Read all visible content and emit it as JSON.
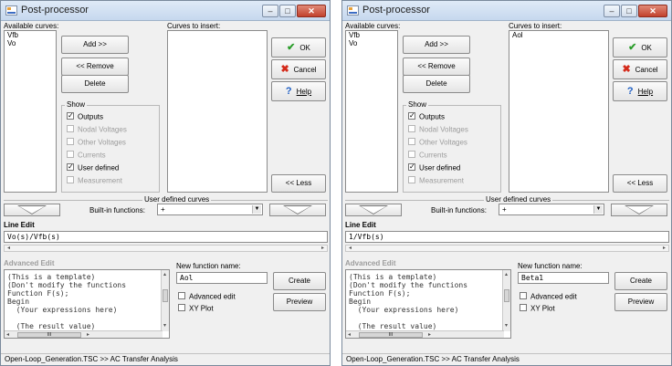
{
  "windows": [
    {
      "title": "Post-processor",
      "controls": {
        "minimize": "–",
        "maximize": "□",
        "close": "✕"
      },
      "available_curves_label": "Available curves:",
      "available_curves": [
        "Vfb",
        "Vo"
      ],
      "curves_to_insert_label": "Curves to insert:",
      "curves_to_insert": [],
      "buttons": {
        "add": "Add >>",
        "remove": "<< Remove",
        "delete": "Delete",
        "ok": "OK",
        "cancel": "Cancel",
        "help": "Help",
        "less": "<< Less",
        "create": "Create",
        "preview": "Preview"
      },
      "icons": {
        "ok": "✔",
        "cancel": "✖",
        "help": "?"
      },
      "show_label": "Show",
      "show_options": [
        {
          "label": "Outputs",
          "checked": true,
          "enabled": true
        },
        {
          "label": "Nodal Voltages",
          "checked": false,
          "enabled": false
        },
        {
          "label": "Other Voltages",
          "checked": false,
          "enabled": false
        },
        {
          "label": "Currents",
          "checked": false,
          "enabled": false
        },
        {
          "label": "User defined",
          "checked": true,
          "enabled": true
        },
        {
          "label": "Measurement",
          "checked": false,
          "enabled": false
        }
      ],
      "user_defined_curves_label": "User defined curves",
      "builtin_functions_label": "Built-in functions:",
      "builtin_functions_value": "+",
      "line_edit_label": "Line Edit",
      "line_edit_value": "Vo(s)/Vfb(s)",
      "advanced_edit_label": "Advanced Edit",
      "advanced_edit_lines": [
        "(This is a template)",
        "(Don't modify the functions",
        "Function F(s);",
        "Begin",
        "  (Your expressions here)",
        "",
        "  (The result value)"
      ],
      "new_function_name_label": "New function name:",
      "new_function_name_value": "Aol",
      "advanced_edit_checkbox": "Advanced edit",
      "xy_plot_checkbox": "XY Plot",
      "scroll_dots": "III",
      "status": "Open-Loop_Generation.TSC >> AC Transfer Analysis"
    },
    {
      "title": "Post-processor",
      "controls": {
        "minimize": "–",
        "maximize": "□",
        "close": "✕"
      },
      "available_curves_label": "Available curves:",
      "available_curves": [
        "Vfb",
        "Vo"
      ],
      "curves_to_insert_label": "Curves to insert:",
      "curves_to_insert": [
        "Aol"
      ],
      "buttons": {
        "add": "Add >>",
        "remove": "<< Remove",
        "delete": "Delete",
        "ok": "OK",
        "cancel": "Cancel",
        "help": "Help",
        "less": "<< Less",
        "create": "Create",
        "preview": "Preview"
      },
      "icons": {
        "ok": "✔",
        "cancel": "✖",
        "help": "?"
      },
      "show_label": "Show",
      "show_options": [
        {
          "label": "Outputs",
          "checked": true,
          "enabled": true
        },
        {
          "label": "Nodal Voltages",
          "checked": false,
          "enabled": false
        },
        {
          "label": "Other Voltages",
          "checked": false,
          "enabled": false
        },
        {
          "label": "Currents",
          "checked": false,
          "enabled": false
        },
        {
          "label": "User defined",
          "checked": true,
          "enabled": true
        },
        {
          "label": "Measurement",
          "checked": false,
          "enabled": false
        }
      ],
      "user_defined_curves_label": "User defined curves",
      "builtin_functions_label": "Built-in functions:",
      "builtin_functions_value": "+",
      "line_edit_label": "Line Edit",
      "line_edit_value": "1/Vfb(s)",
      "advanced_edit_label": "Advanced Edit",
      "advanced_edit_lines": [
        "(This is a template)",
        "(Don't modify the functions",
        "Function F(s);",
        "Begin",
        "  (Your expressions here)",
        "",
        "  (The result value)"
      ],
      "new_function_name_label": "New function name:",
      "new_function_name_value": "Beta1",
      "advanced_edit_checkbox": "Advanced edit",
      "xy_plot_checkbox": "XY Plot",
      "scroll_dots": "III",
      "status": "Open-Loop_Generation.TSC >> AC Transfer Analysis"
    }
  ]
}
